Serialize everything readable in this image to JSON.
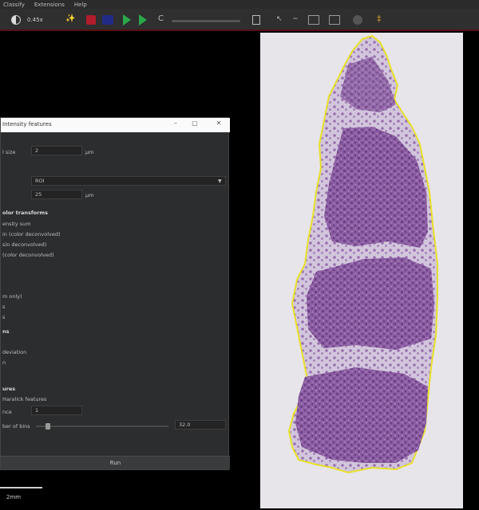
{
  "menu": [
    "Classify",
    "Extensions",
    "Help"
  ],
  "toolbar": {
    "brush_label": "0.45x",
    "icons": [
      "contrast-icon",
      "wand-icon",
      "color-square-red",
      "color-square-blue",
      "play-icon",
      "play-icon",
      "refresh-icon",
      "grid-icon",
      "selection-icon",
      "wave-icon",
      "bulb-icon"
    ]
  },
  "dialog": {
    "title": "Intensity features",
    "fields": {
      "pixel_size_label": "l size",
      "pixel_size_value": "2",
      "pixel_size_unit": "µm",
      "region_value": "ROI",
      "tile_size_value": "25",
      "tile_size_unit": "µm"
    },
    "sections": {
      "color_transforms": "olor transforms",
      "transform_1": "ensity sum",
      "transform_2": "in (color deconvolved)",
      "transform_3": "sin deconvolved)",
      "transform_4": "(color deconvolved)",
      "opt_1": "m only)",
      "opt_2": "s",
      "opt_3": "s",
      "sec_2": "ns",
      "opt_4": "deviation",
      "opt_5": "n",
      "sec_3": "ures",
      "haralick": "Haralick features",
      "distance_label": "nce",
      "distance_value": "1",
      "bins_label": "ber of bins",
      "bins_value": "32.0"
    },
    "run_label": "Run"
  },
  "scalebar": {
    "label": "2mm"
  },
  "colors": {
    "annotation": "#e8e02a",
    "tissue": "#8a5aa0",
    "slide_bg": "#e7e5ea"
  }
}
